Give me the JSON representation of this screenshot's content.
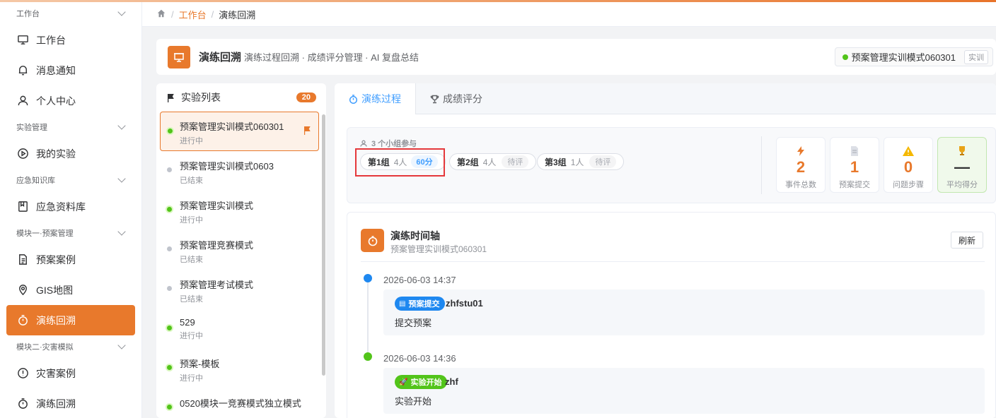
{
  "sidebar": {
    "groups": [
      {
        "label": "工作台",
        "items": [
          {
            "label": "工作台",
            "icon": "monitor-icon"
          },
          {
            "label": "消息通知",
            "icon": "bell-icon"
          },
          {
            "label": "个人中心",
            "icon": "user-icon"
          }
        ]
      },
      {
        "label": "实验管理",
        "items": [
          {
            "label": "我的实验",
            "icon": "play-circle-icon"
          }
        ]
      },
      {
        "label": "应急知识库",
        "items": [
          {
            "label": "应急资料库",
            "icon": "book-icon"
          }
        ]
      },
      {
        "label": "模块一·预案管理",
        "items": [
          {
            "label": "预案案例",
            "icon": "document-icon"
          },
          {
            "label": "GIS地图",
            "icon": "map-pin-icon"
          },
          {
            "label": "演练回溯",
            "icon": "stopwatch-icon",
            "active": true
          }
        ]
      },
      {
        "label": "模块二·灾害模拟",
        "items": [
          {
            "label": "灾害案例",
            "icon": "alert-circle-icon"
          },
          {
            "label": "演练回溯",
            "icon": "stopwatch-icon"
          }
        ]
      }
    ]
  },
  "breadcrumb": {
    "parent": "工作台",
    "current": "演练回溯"
  },
  "header": {
    "title": "演练回溯",
    "subtitle": "演练过程回溯 · 成绩评分管理 · AI 复盘总结",
    "current_exp": "预案管理实训模式060301",
    "current_tag": "实训"
  },
  "exp_list": {
    "title": "实验列表",
    "count": "20",
    "items": [
      {
        "name": "预案管理实训模式060301",
        "status": "进行中",
        "active": true
      },
      {
        "name": "预案管理实训模式0603",
        "status": "已结束",
        "active": false
      },
      {
        "name": "预案管理实训模式",
        "status": "进行中",
        "active": true
      },
      {
        "name": "预案管理竞赛模式",
        "status": "已结束",
        "active": false
      },
      {
        "name": "预案管理考试模式",
        "status": "已结束",
        "active": false
      },
      {
        "name": "529",
        "status": "进行中",
        "active": true
      },
      {
        "name": "预案-模板",
        "status": "进行中",
        "active": true
      },
      {
        "name": "0520模块一竞赛模式独立模式",
        "status": "",
        "active": true
      }
    ]
  },
  "tabs": {
    "process": "演练过程",
    "score": "成绩评分"
  },
  "groups": {
    "header": "3 个小组参与",
    "chips": [
      {
        "name": "第1组",
        "count": "4人",
        "score": "60分"
      },
      {
        "name": "第2组",
        "count": "4人",
        "pending": "待评"
      },
      {
        "name": "第3组",
        "count": "1人",
        "pending": "待评"
      }
    ]
  },
  "stats": [
    {
      "value": "2",
      "label": "事件总数",
      "icon": "lightning-icon"
    },
    {
      "value": "1",
      "label": "预案提交",
      "icon": "document-icon"
    },
    {
      "value": "0",
      "label": "问题步骤",
      "icon": "warning-icon"
    },
    {
      "value": "—",
      "label": "平均得分",
      "icon": "trophy-icon"
    }
  ],
  "timeline": {
    "title": "演练时间轴",
    "subtitle": "预案管理实训模式060301",
    "refresh": "刷新",
    "events": [
      {
        "time": "2026-06-03 14:37",
        "badge": "预案提交",
        "badge_icon": "document-icon",
        "user": "zhfstu01",
        "message": "提交预案",
        "color": "#1e88f0"
      },
      {
        "time": "2026-06-03 14:36",
        "badge": "实验开始",
        "badge_icon": "rocket-icon",
        "user": "zhf",
        "message": "实验开始",
        "color": "#52c41a"
      }
    ]
  },
  "colors": {
    "accent": "#e8792c",
    "primary": "#409eff",
    "success": "#52c41a"
  }
}
